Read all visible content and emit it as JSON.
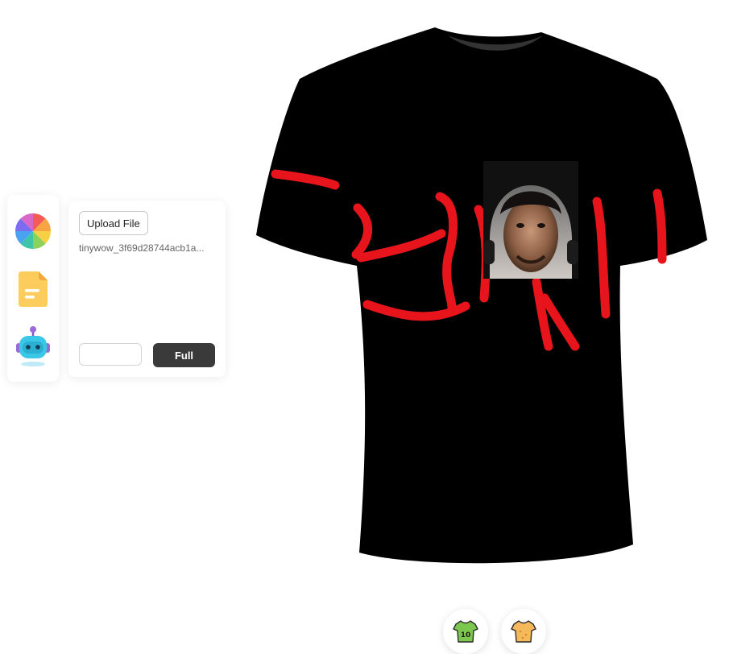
{
  "toolbar": {
    "items": [
      {
        "icon": "color-wheel-icon"
      },
      {
        "icon": "document-icon"
      },
      {
        "icon": "robot-icon"
      }
    ]
  },
  "panel": {
    "upload_label": "Upload File",
    "filename": "tinywow_3f69d28744acb1a...",
    "size_value": "",
    "full_label": "Full"
  },
  "preview": {
    "shirt_color": "#000000",
    "print_color": "#e8141b"
  },
  "bottom_bar": {
    "items": [
      {
        "icon": "jersey-number-icon",
        "label": "10"
      },
      {
        "icon": "tshirt-icon"
      }
    ]
  }
}
